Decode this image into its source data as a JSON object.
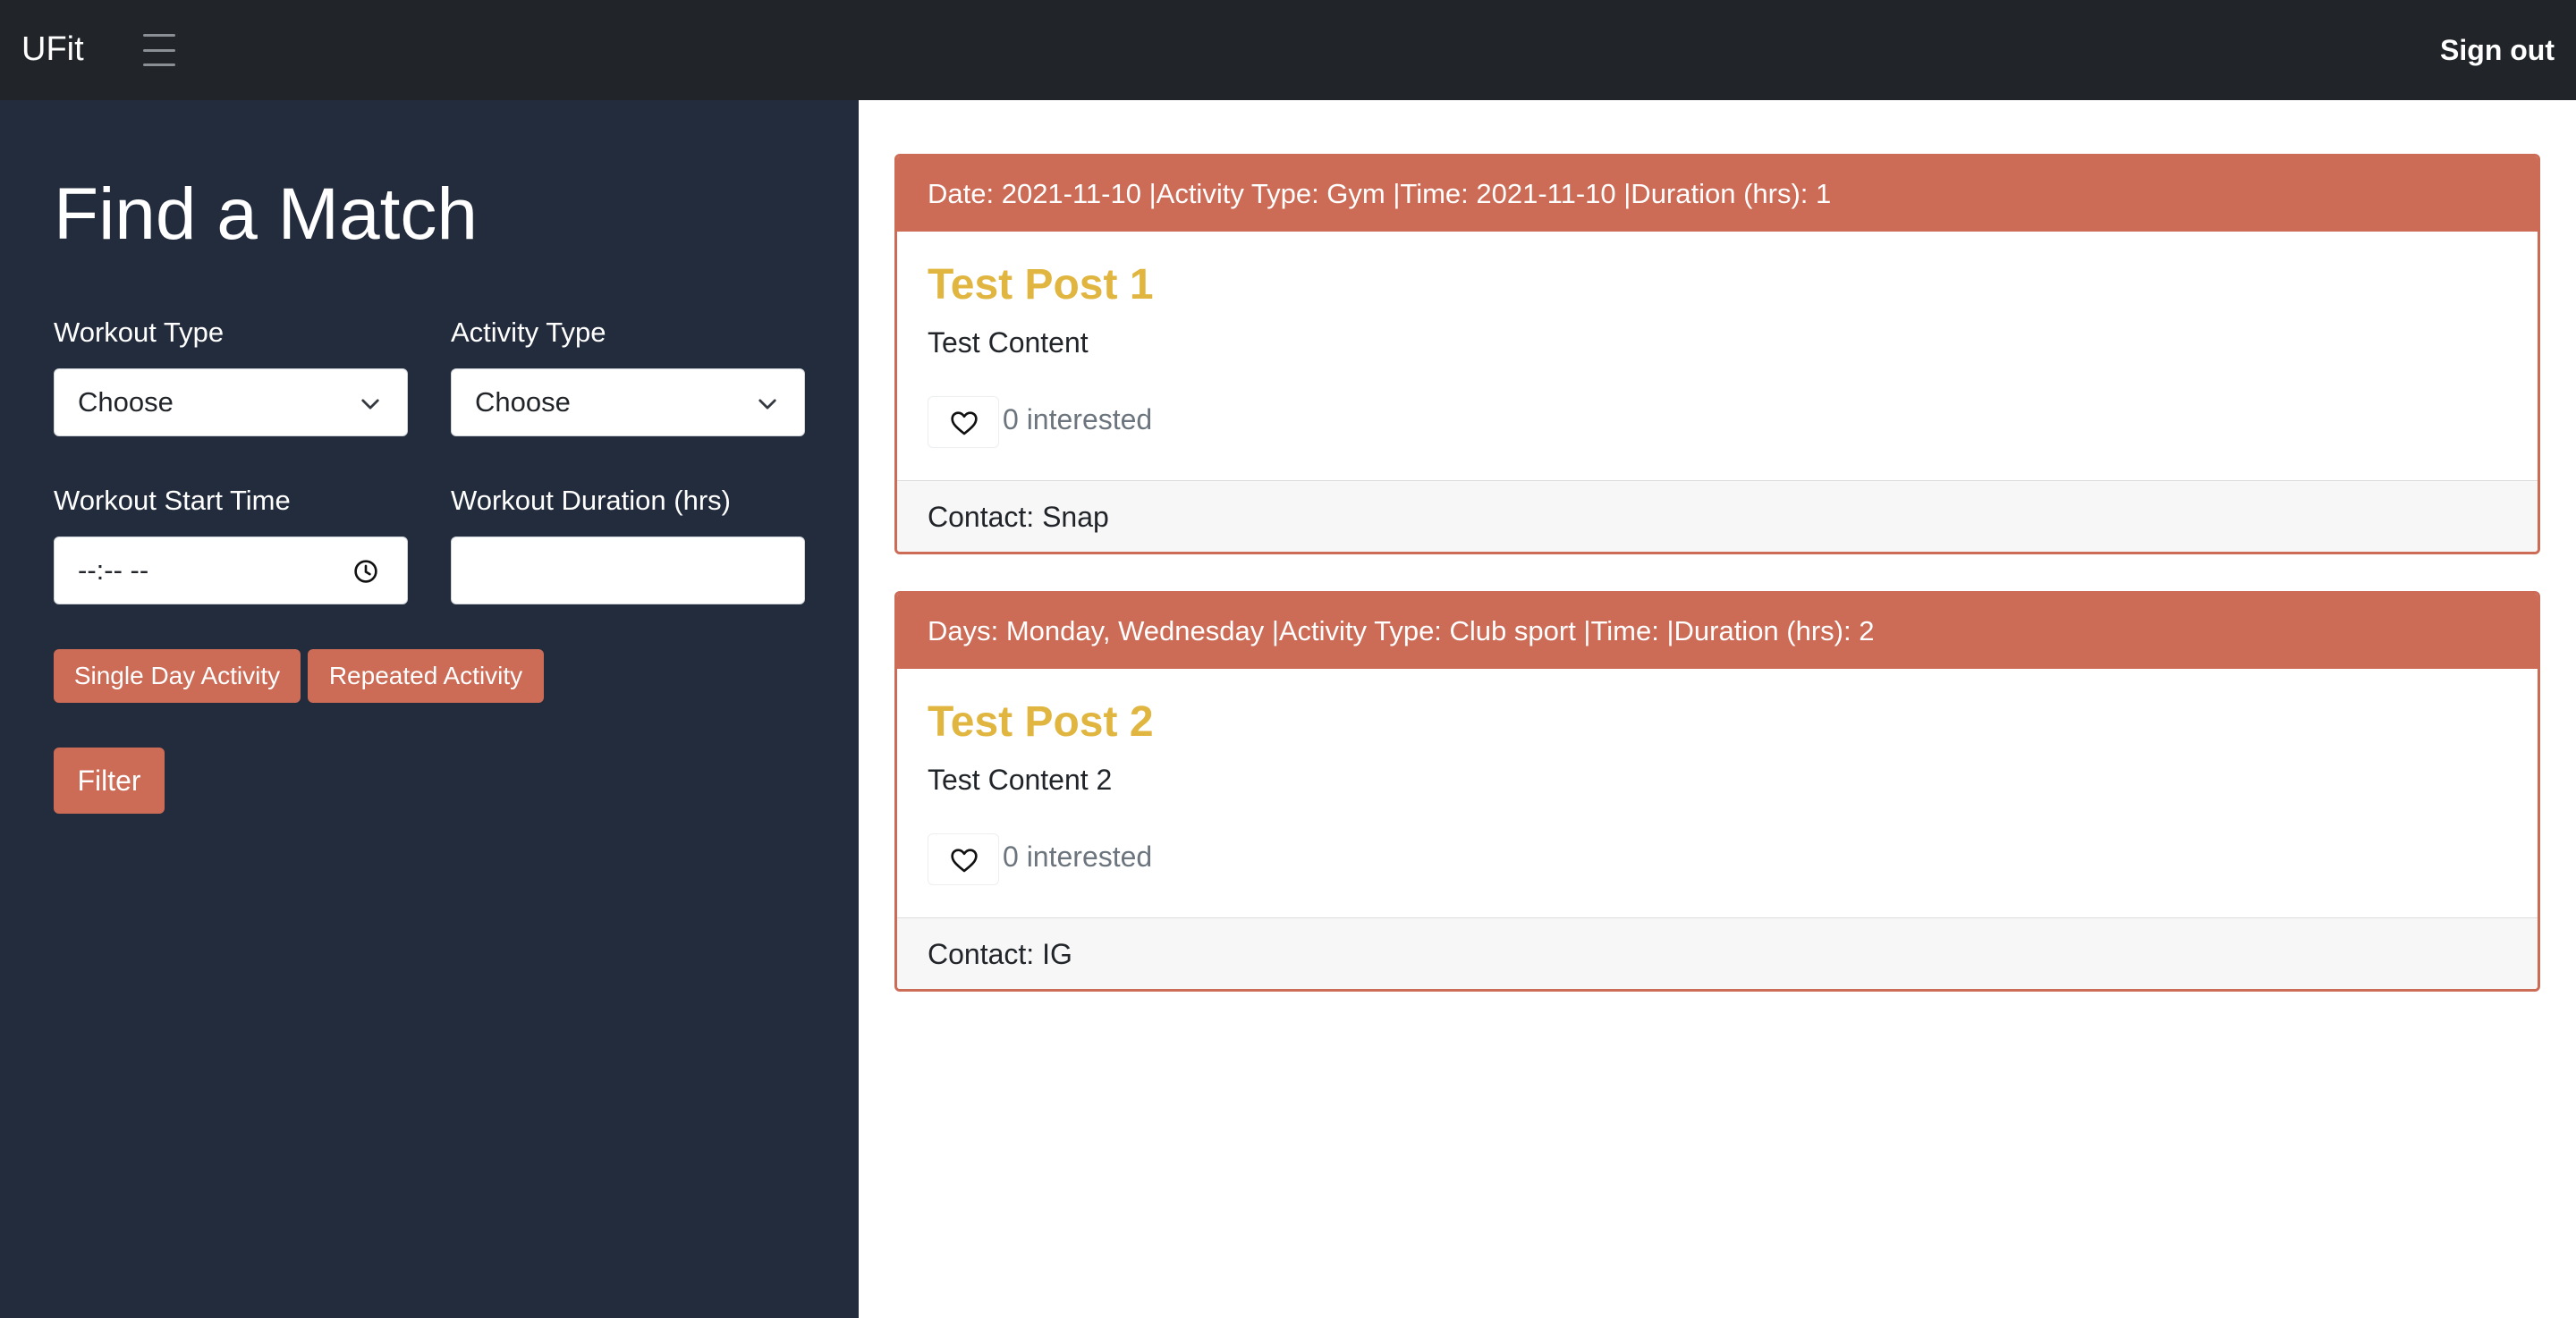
{
  "app": {
    "brand": "UFit",
    "sign_out": "Sign out"
  },
  "sidebar": {
    "title": "Find a Match",
    "workout_type": {
      "label": "Workout Type",
      "value": "Choose"
    },
    "activity_type": {
      "label": "Activity Type",
      "value": "Choose"
    },
    "start_time": {
      "label": "Workout Start Time",
      "value": "--:-- --"
    },
    "duration": {
      "label": "Workout Duration (hrs)",
      "value": ""
    },
    "single_day": "Single Day Activity",
    "repeated": "Repeated Activity",
    "filter": "Filter"
  },
  "posts": [
    {
      "header": "Date: 2021-11-10 |Activity Type: Gym |Time: 2021-11-10 |Duration (hrs): 1",
      "title": "Test Post 1",
      "content": "Test Content",
      "interested": "0 interested",
      "contact": "Contact: Snap"
    },
    {
      "header": "Days: Monday, Wednesday |Activity Type: Club sport |Time: |Duration (hrs): 2",
      "title": "Test Post 2",
      "content": "Test Content 2",
      "interested": "0 interested",
      "contact": "Contact: IG"
    }
  ],
  "colors": {
    "navbar": "#212529",
    "sidebar": "#232c3d",
    "accent": "#cc6b56",
    "title": "#e0b540"
  },
  "icons": {
    "menu": "hamburger-icon",
    "dropdown": "chevron-down-icon",
    "time": "clock-icon",
    "like": "heart-icon"
  }
}
